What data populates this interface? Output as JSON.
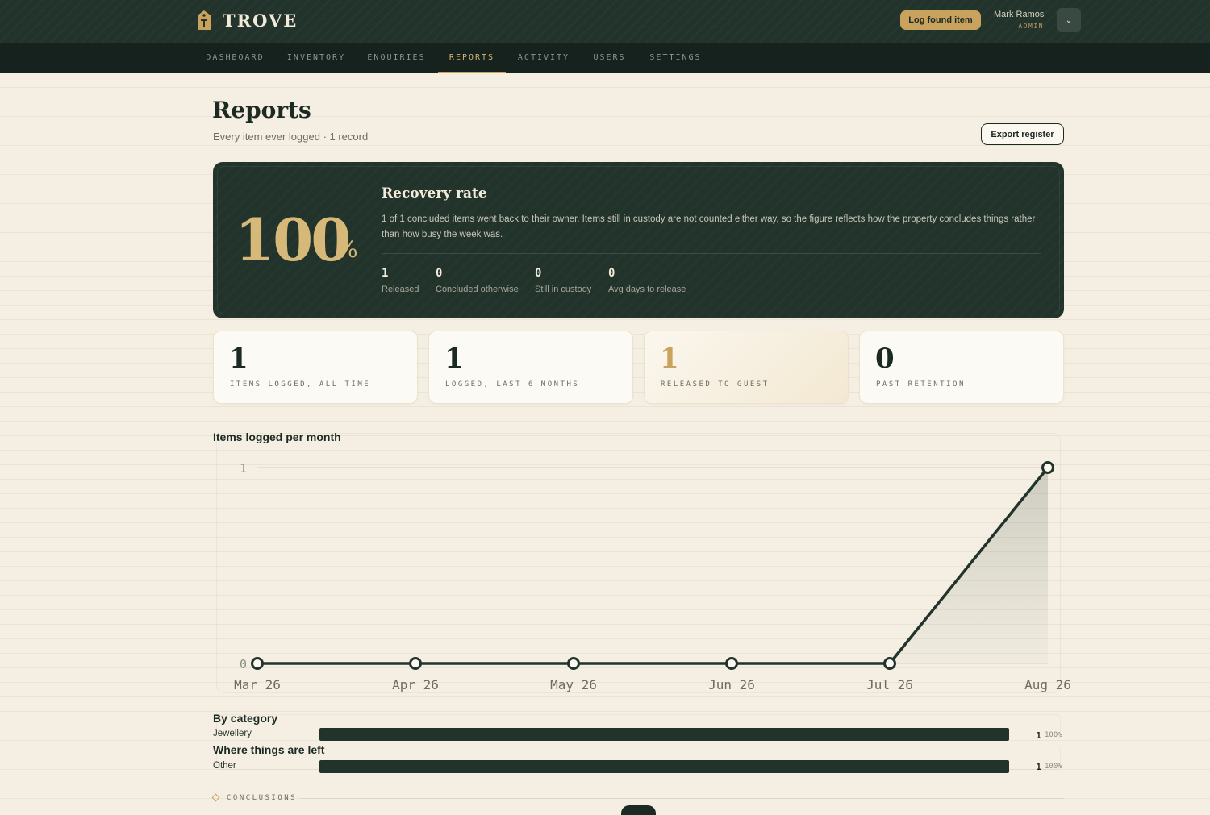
{
  "app": {
    "name": "TROVE",
    "log_button": "Log found item"
  },
  "user": {
    "name": "Mark Ramos",
    "role": "ADMIN",
    "menu_glyph": "⌄"
  },
  "nav": {
    "items": [
      "DASHBOARD",
      "INVENTORY",
      "ENQUIRIES",
      "REPORTS",
      "ACTIVITY",
      "USERS",
      "SETTINGS"
    ],
    "active": "REPORTS"
  },
  "page": {
    "title": "Reports",
    "subtitle": "Every item ever logged · 1 record",
    "export_button": "Export register"
  },
  "recovery": {
    "rate": "100",
    "unit": "%",
    "title": "Recovery rate",
    "description": "1 of 1 concluded items went back to their owner. Items still in custody are not counted either way, so the figure reflects how the property concludes things rather than how busy the week was.",
    "stats": [
      {
        "value": "1",
        "label": "Released"
      },
      {
        "value": "0",
        "label": "Concluded otherwise"
      },
      {
        "value": "0",
        "label": "Still in custody"
      },
      {
        "value": "0",
        "label": "Avg days to release"
      }
    ]
  },
  "cards": [
    {
      "value": "1",
      "label": "ITEMS LOGGED, ALL TIME"
    },
    {
      "value": "1",
      "label": "LOGGED, LAST 6 MONTHS"
    },
    {
      "value": "1",
      "label": "RELEASED TO GUEST"
    },
    {
      "value": "0",
      "label": "PAST RETENTION"
    }
  ],
  "chart_data": {
    "type": "line",
    "title": "Items logged per month",
    "x": [
      "Mar 26",
      "Apr 26",
      "May 26",
      "Jun 26",
      "Jul 26",
      "Aug 26"
    ],
    "series": [
      {
        "values": [
          0,
          0,
          0,
          0,
          0,
          1
        ]
      }
    ],
    "ylim": [
      0,
      1
    ],
    "yticks": [
      "0",
      "1"
    ],
    "grid": true,
    "colors": {
      "line": "#22332c",
      "area": "#22332c"
    }
  },
  "by_category": {
    "title": "By category",
    "rows": [
      {
        "label": "Jewellery",
        "count": "1",
        "pct": "100%",
        "fraction": 1.0
      }
    ]
  },
  "by_location": {
    "title": "Where things are left",
    "rows": [
      {
        "label": "Other",
        "count": "1",
        "pct": "100%",
        "fraction": 1.0
      }
    ]
  },
  "conclusions": {
    "label": "CONCLUSIONS"
  },
  "colors": {
    "accent": "#c9a25e",
    "dark": "#22332c",
    "background": "#f4efe2"
  }
}
